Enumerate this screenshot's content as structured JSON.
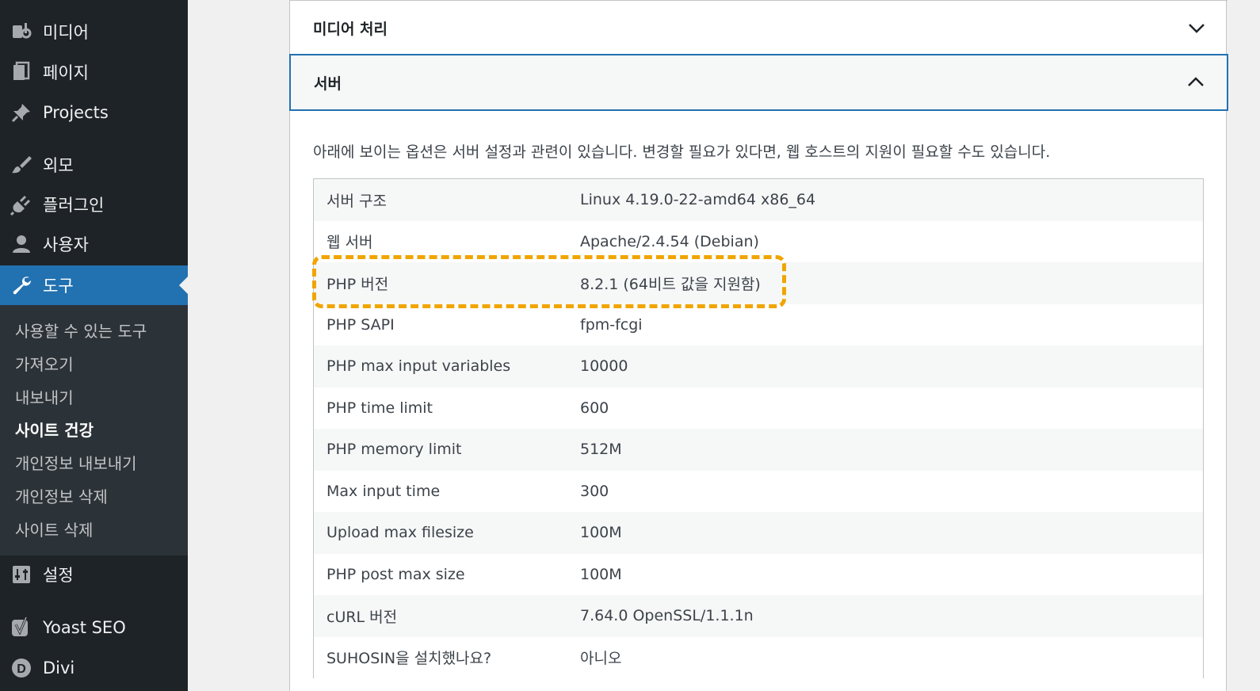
{
  "sidebar": {
    "items": [
      {
        "label": "미디어",
        "icon": "media-icon"
      },
      {
        "label": "페이지",
        "icon": "pages-icon"
      },
      {
        "label": "Projects",
        "icon": "pin-icon"
      },
      {
        "label": "외모",
        "icon": "appearance-brush-icon"
      },
      {
        "label": "플러그인",
        "icon": "plugin-icon"
      },
      {
        "label": "사용자",
        "icon": "user-icon"
      },
      {
        "label": "도구",
        "icon": "wrench-icon"
      },
      {
        "label": "설정",
        "icon": "settings-sliders-icon"
      },
      {
        "label": "Yoast SEO",
        "icon": "yoast-icon"
      },
      {
        "label": "Divi",
        "icon": "divi-icon"
      }
    ],
    "submenu": [
      {
        "label": "사용할 수 있는 도구"
      },
      {
        "label": "가져오기"
      },
      {
        "label": "내보내기"
      },
      {
        "label": "사이트 건강"
      },
      {
        "label": "개인정보 내보내기"
      },
      {
        "label": "개인정보 삭제"
      },
      {
        "label": "사이트 삭제"
      }
    ],
    "active_color": "#2271b1"
  },
  "panel": {
    "media_section": "미디어 처리",
    "server_section": "서버",
    "description": "아래에 보이는 옵션은 서버 설정과 관련이 있습니다. 변경할 필요가 있다면, 웹 호스트의 지원이 필요할 수도 있습니다.",
    "rows": [
      {
        "key": "서버 구조",
        "value": "Linux 4.19.0-22-amd64 x86_64"
      },
      {
        "key": "웹 서버",
        "value": "Apache/2.4.54 (Debian)"
      },
      {
        "key": "PHP 버전",
        "value": "8.2.1 (64비트 값을 지원함)"
      },
      {
        "key": "PHP SAPI",
        "value": "fpm-fcgi"
      },
      {
        "key": "PHP max input variables",
        "value": "10000"
      },
      {
        "key": "PHP time limit",
        "value": "600"
      },
      {
        "key": "PHP memory limit",
        "value": "512M"
      },
      {
        "key": "Max input time",
        "value": "300"
      },
      {
        "key": "Upload max filesize",
        "value": "100M"
      },
      {
        "key": "PHP post max size",
        "value": "100M"
      },
      {
        "key": "cURL 버전",
        "value": "7.64.0 OpenSSL/1.1.1n"
      },
      {
        "key": "SUHOSIN을 설치했나요?",
        "value": "아니오"
      }
    ],
    "highlight_color": "#f0a500"
  }
}
